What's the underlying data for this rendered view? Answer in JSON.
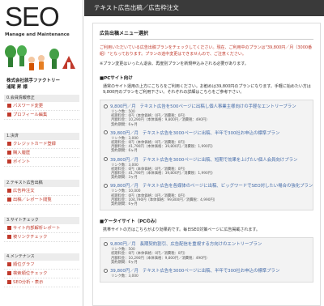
{
  "sidebar": {
    "logo": "SEO",
    "logo_sub": "Manage and Maintenance",
    "company_line1": "株式会社就手ファクトリー",
    "company_line2": "浦尾 昇 様",
    "groups": [
      {
        "header": "0.会員情報修正",
        "items": [
          "パスワード変更",
          "プロフィール編集"
        ]
      },
      {
        "header": "1.決済",
        "items": [
          "クレジットカード登録",
          "購入履歴",
          "ポイント"
        ]
      },
      {
        "header": "2.テキスト広告出稿",
        "items": [
          "広告枠注文",
          "出稿／レポート閲覧"
        ]
      },
      {
        "header": "3.サイトチェック",
        "items": [
          "サイト内部解析レポート",
          "被リンクチェック"
        ]
      },
      {
        "header": "4.メンテナンス",
        "items": [
          "順位グラフ",
          "検索順位チェック",
          "SEO分析・表示"
        ]
      }
    ]
  },
  "topbar": {
    "title": "テキスト広告出稿／広告枠注文"
  },
  "content": {
    "section_title": "広告出稿メニュー選択",
    "intro": "ご利用いただいている広告出稿プランをチェックしてください。現在、ご利用中のプランは\"39,800円／月（3000番組）\"となっております。プランの途中変更はできませんので、ご注意ください。",
    "note": "※プラン変更はいったん退会、再度別プランを新規申込みされる必要があります。",
    "pc_title": "■PCサイト向け",
    "pc_desc": "通常のサイト運用の上方にこちらをご利用ください。お勧めは39,800円のプランになります。手軽に始めたい方は9,800円のプランをご利用下さい。それぞれの詳細はこちらをご参考下さい。",
    "pc_plans": [
      {
        "price": "9,800円／月",
        "desc": "テキスト広告を500ページに出稿し個人事業主様向けの手軽なエントリープラン",
        "details": [
          "リンク数：500",
          "初期料金：0円（本体価格：0円／消費税：0円）",
          "月額料金：10,290円（本体価格：9,800円／消費税：490円）",
          "契約期間：6ヶ月"
        ]
      },
      {
        "price": "39,800円／月",
        "desc": "テキスト広告を3000ページに出稿、半年で300社お申込の標準プラン",
        "details": [
          "リンク数：3,000",
          "初期料金：0円（本体価格：0円／消費税：0円）",
          "月額料金：41,790円（本体価格：39,800円／消費税：1,990円）",
          "契約期間：6ヶ月"
        ]
      },
      {
        "price": "39,800円／月",
        "desc": "テキスト広告を3000ページに出稿、短期で効果を上げたい個人会員向けプラン",
        "details": [
          "リンク数：3,000",
          "初期料金：0円（本体価格：0円／消費税：0円）",
          "月額料金：41,790円（本体価格：39,800円／消費税：1,990円）",
          "契約期間：3ヶ月"
        ]
      },
      {
        "price": "99,800円／月",
        "desc": "テキスト広告を各媒体のページに出稿、ビッグワードでSEO対したい場合の強化プラン",
        "details": [
          "リンク数：10,000",
          "初期料金：0円（本体価格：0円／消費税：0円）",
          "月額料金：104,790円（本体価格：99,800円／消費税：4,990円）",
          "契約期間：6ヶ月"
        ]
      }
    ],
    "mobile_title": "■ケータイサイト（PCのみ）",
    "mobile_desc": "携帯サイトの方はこちらがより効果的です。毎日SEO対策ページに広告掲載されます。",
    "mobile_plans": [
      {
        "price": "9,800円／月",
        "desc": "長期契約割引、広告配信を重視する方向けのエントリープラン",
        "details": [
          "リンク数：500",
          "初期料金：0円（本体価格：0円／消費税：0円）",
          "月額料金：10,290円（本体価格：9,800円／消費税：490円）",
          "契約期間：6ヶ月"
        ]
      },
      {
        "price": "39,800円／月",
        "desc": "テキスト広告を3000ページに出稿、半年で300社お申込の標準プラン",
        "details": [
          "リンク数：3,000"
        ]
      }
    ]
  },
  "colors": {
    "topbar": "#3a3a3a",
    "accent_red": "#c0392b",
    "link_blue": "#4169a8"
  }
}
